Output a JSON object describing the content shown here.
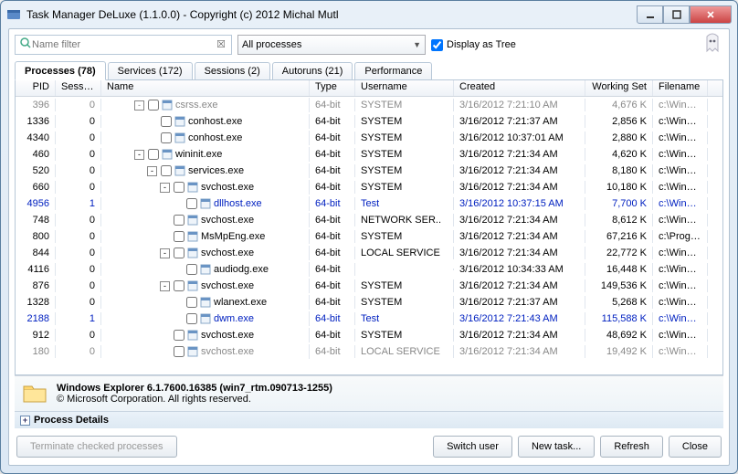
{
  "window": {
    "title": "Task Manager DeLuxe (1.1.0.0) - Copyright (c) 2012 Michal Mutl"
  },
  "toolbar": {
    "filter_placeholder": "Name filter",
    "combo_value": "All processes",
    "tree_label": "Display as Tree",
    "tree_checked": true
  },
  "tabs": [
    {
      "label": "Processes (78)",
      "active": true
    },
    {
      "label": "Services (172)"
    },
    {
      "label": "Sessions (2)"
    },
    {
      "label": "Autoruns (21)"
    },
    {
      "label": "Performance"
    }
  ],
  "columns": {
    "pid": "PID",
    "session": "Session",
    "name": "Name",
    "type": "Type",
    "user": "Username",
    "created": "Created",
    "ws": "Working Set",
    "file": "Filename"
  },
  "rows": [
    {
      "pid": "396",
      "sess": "0",
      "name": "csrss.exe",
      "depth": 2,
      "expander": "-",
      "type": "64-bit",
      "user": "SYSTEM",
      "created": "3/16/2012 7:21:10 AM",
      "ws": "4,676 K",
      "file": "c:\\Windo..",
      "dim": true
    },
    {
      "pid": "1336",
      "sess": "0",
      "name": "conhost.exe",
      "depth": 3,
      "type": "64-bit",
      "user": "SYSTEM",
      "created": "3/16/2012 7:21:37 AM",
      "ws": "2,856 K",
      "file": "c:\\Windo.."
    },
    {
      "pid": "4340",
      "sess": "0",
      "name": "conhost.exe",
      "depth": 3,
      "type": "64-bit",
      "user": "SYSTEM",
      "created": "3/16/2012 10:37:01 AM",
      "ws": "2,880 K",
      "file": "c:\\Windo.."
    },
    {
      "pid": "460",
      "sess": "0",
      "name": "wininit.exe",
      "depth": 2,
      "expander": "-",
      "type": "64-bit",
      "user": "SYSTEM",
      "created": "3/16/2012 7:21:34 AM",
      "ws": "4,620 K",
      "file": "c:\\Windo.."
    },
    {
      "pid": "520",
      "sess": "0",
      "name": "services.exe",
      "depth": 3,
      "expander": "-",
      "type": "64-bit",
      "user": "SYSTEM",
      "created": "3/16/2012 7:21:34 AM",
      "ws": "8,180 K",
      "file": "c:\\Windo.."
    },
    {
      "pid": "660",
      "sess": "0",
      "name": "svchost.exe",
      "depth": 4,
      "expander": "-",
      "type": "64-bit",
      "user": "SYSTEM",
      "created": "3/16/2012 7:21:34 AM",
      "ws": "10,180 K",
      "file": "c:\\Windo.."
    },
    {
      "pid": "4956",
      "sess": "1",
      "name": "dllhost.exe",
      "depth": 5,
      "type": "64-bit",
      "user": "Test",
      "created": "3/16/2012 10:37:15 AM",
      "ws": "7,700 K",
      "file": "c:\\Windo..",
      "blue": true
    },
    {
      "pid": "748",
      "sess": "0",
      "name": "svchost.exe",
      "depth": 4,
      "type": "64-bit",
      "user": "NETWORK SER..",
      "created": "3/16/2012 7:21:34 AM",
      "ws": "8,612 K",
      "file": "c:\\Windo.."
    },
    {
      "pid": "800",
      "sess": "0",
      "name": "MsMpEng.exe",
      "depth": 4,
      "type": "64-bit",
      "user": "SYSTEM",
      "created": "3/16/2012 7:21:34 AM",
      "ws": "67,216 K",
      "file": "c:\\Progra.."
    },
    {
      "pid": "844",
      "sess": "0",
      "name": "svchost.exe",
      "depth": 4,
      "expander": "-",
      "type": "64-bit",
      "user": "LOCAL SERVICE",
      "created": "3/16/2012 7:21:34 AM",
      "ws": "22,772 K",
      "file": "c:\\Windo.."
    },
    {
      "pid": "4116",
      "sess": "0",
      "name": "audiodg.exe",
      "depth": 5,
      "type": "64-bit",
      "user": "",
      "created": "3/16/2012 10:34:33 AM",
      "ws": "16,448 K",
      "file": "c:\\Windo.."
    },
    {
      "pid": "876",
      "sess": "0",
      "name": "svchost.exe",
      "depth": 4,
      "expander": "-",
      "type": "64-bit",
      "user": "SYSTEM",
      "created": "3/16/2012 7:21:34 AM",
      "ws": "149,536 K",
      "file": "c:\\Windo.."
    },
    {
      "pid": "1328",
      "sess": "0",
      "name": "wlanext.exe",
      "depth": 5,
      "type": "64-bit",
      "user": "SYSTEM",
      "created": "3/16/2012 7:21:37 AM",
      "ws": "5,268 K",
      "file": "c:\\Windo.."
    },
    {
      "pid": "2188",
      "sess": "1",
      "name": "dwm.exe",
      "depth": 5,
      "type": "64-bit",
      "user": "Test",
      "created": "3/16/2012 7:21:43 AM",
      "ws": "115,588 K",
      "file": "c:\\Windo..",
      "blue": true
    },
    {
      "pid": "912",
      "sess": "0",
      "name": "svchost.exe",
      "depth": 4,
      "type": "64-bit",
      "user": "SYSTEM",
      "created": "3/16/2012 7:21:34 AM",
      "ws": "48,692 K",
      "file": "c:\\Windo.."
    },
    {
      "pid": "180",
      "sess": "0",
      "name": "svchost.exe",
      "depth": 4,
      "type": "64-bit",
      "user": "LOCAL SERVICE",
      "created": "3/16/2012 7:21:34 AM",
      "ws": "19,492 K",
      "file": "c:\\Windo..",
      "dim": true
    }
  ],
  "selected": {
    "title": "Windows Explorer 6.1.7600.16385 (win7_rtm.090713-1255)",
    "copyright": "© Microsoft Corporation. All rights reserved."
  },
  "details_header": "Process Details",
  "buttons": {
    "terminate": "Terminate checked processes",
    "switch": "Switch user",
    "newtask": "New task...",
    "refresh": "Refresh",
    "close": "Close"
  }
}
